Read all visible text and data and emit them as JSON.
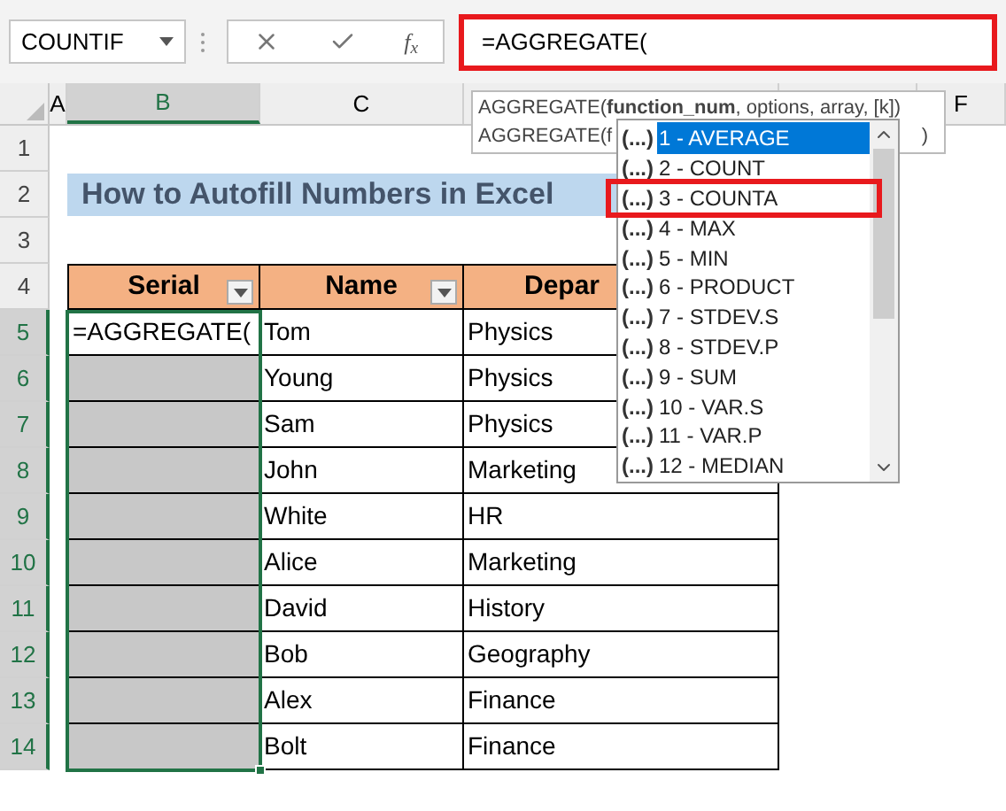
{
  "formula_bar": {
    "name_box": "COUNTIF",
    "function_button": "f$_{x}$",
    "formula": "=AGGREGATE(",
    "highlighted": true
  },
  "column_headers": [
    {
      "label": "A",
      "selected": false
    },
    {
      "label": "B",
      "selected": true
    },
    {
      "label": "C",
      "selected": false
    },
    {
      "label": "F",
      "selected": false
    }
  ],
  "row_numbers": [
    "1",
    "2",
    "3",
    "4",
    "5",
    "6",
    "7",
    "8",
    "9",
    "10",
    "11",
    "12",
    "13",
    "14"
  ],
  "title": "How to Autofill Numbers in Excel",
  "table": {
    "columns": [
      {
        "label": "Serial",
        "filter": true
      },
      {
        "label": "Name",
        "filter": true
      },
      {
        "label": "Depar",
        "filter": false
      }
    ],
    "rows": [
      {
        "serial": "=AGGREGATE(",
        "selected": false,
        "name": "Tom",
        "department": "Physics"
      },
      {
        "selected": true,
        "name": "Young",
        "department": "Physics"
      },
      {
        "selected": true,
        "name": "Sam",
        "department": "Physics"
      },
      {
        "selected": true,
        "name": "John",
        "department": "Marketing"
      },
      {
        "selected": true,
        "name": "White",
        "department": "HR"
      },
      {
        "selected": true,
        "name": "Alice",
        "department": "Marketing"
      },
      {
        "selected": true,
        "name": "David",
        "department": "History"
      },
      {
        "selected": true,
        "name": "Bob",
        "department": "Geography"
      },
      {
        "selected": true,
        "name": "Alex",
        "department": "Finance"
      },
      {
        "selected": true,
        "name": "Bolt",
        "department": "Finance"
      }
    ]
  },
  "tooltip": {
    "line_1": "AGGREGATE(**function_num**, options, array, [k])",
    "line_2_start": "AGGREGATE(f",
    "line_2_end": ")"
  },
  "autocomplete": [
    {
      "prefix": "(...)",
      "label": "1 - AVERAGE",
      "selected": true,
      "highlighted": false
    },
    {
      "prefix": "(...)",
      "label": "2 - COUNT",
      "selected": false,
      "highlighted": false
    },
    {
      "prefix": "(...)",
      "label": "3 - COUNTA",
      "selected": false,
      "highlighted": true
    },
    {
      "prefix": "(...)",
      "label": "4 - MAX",
      "selected": false,
      "highlighted": false
    },
    {
      "prefix": "(...)",
      "label": "5 - MIN",
      "selected": false,
      "highlighted": false
    },
    {
      "prefix": "(...)",
      "label": "6 - PRODUCT",
      "selected": false,
      "highlighted": false
    },
    {
      "prefix": "(...)",
      "label": "7 - STDEV.S",
      "selected": false,
      "highlighted": false
    },
    {
      "prefix": "(...)",
      "label": "8 - STDEV.P",
      "selected": false,
      "highlighted": false
    },
    {
      "prefix": "(...)",
      "label": "9 - SUM",
      "selected": false,
      "highlighted": false
    },
    {
      "prefix": "(...)",
      "label": "10 - VAR.S",
      "selected": false,
      "highlighted": false
    },
    {
      "prefix": "(...)",
      "label": "11 - VAR.P",
      "selected": false,
      "highlighted": false
    },
    {
      "prefix": "(...)",
      "label": "12 - MEDIAN",
      "selected": false,
      "highlighted": false
    }
  ]
}
